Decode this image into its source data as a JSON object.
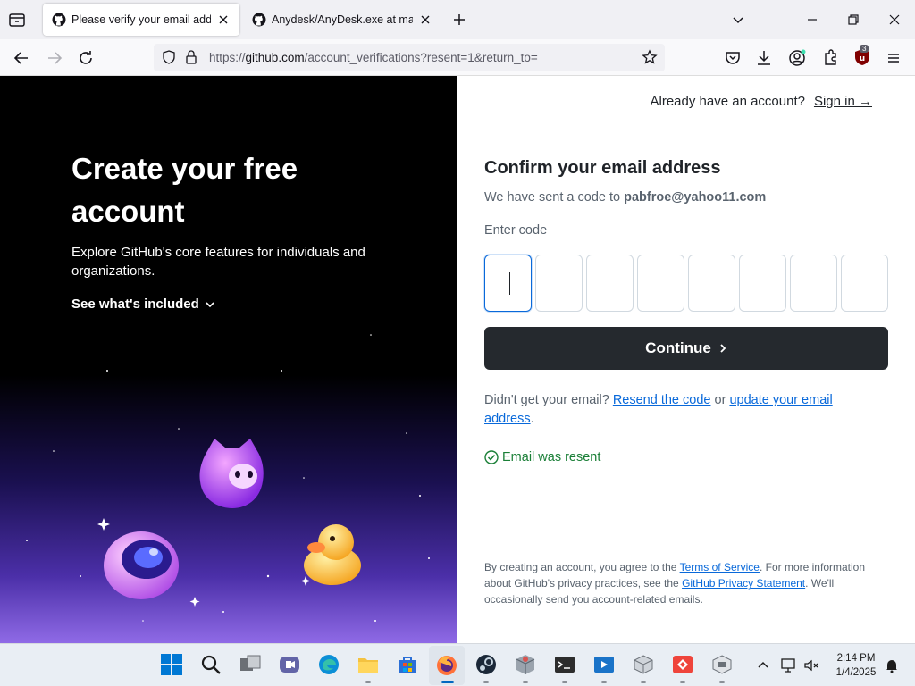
{
  "browser": {
    "tabs": [
      {
        "title": "Please verify your email address",
        "active": true
      },
      {
        "title": "Anydesk/AnyDesk.exe at main",
        "active": false
      }
    ],
    "url_prefix": "https://",
    "url_domain": "github.com",
    "url_path": "/account_verifications?resent=1&return_to=",
    "extension_badge": "3"
  },
  "hero": {
    "title": "Create your free account",
    "subtitle": "Explore GitHub's core features for individuals and organizations.",
    "whats_included": "See what's included"
  },
  "form": {
    "have_account": "Already have an account?",
    "sign_in": "Sign in →",
    "title": "Confirm your email address",
    "sent_text": "We have sent a code to",
    "email": "pabfroe@yahoo11.com",
    "enter_code": "Enter code",
    "code_digits": [
      "",
      "",
      "",
      "",
      "",
      "",
      "",
      ""
    ],
    "continue": "Continue",
    "didnt_get": "Didn't get your email?",
    "resend": "Resend the code",
    "or": "or",
    "update": "update your email address",
    "resent_status": "Email was resent",
    "terms_1": "By creating an account, you agree to the",
    "terms_link": "Terms of Service",
    "terms_2": ". For more information about GitHub's privacy practices, see the",
    "privacy_link": "GitHub Privacy Statement",
    "terms_3": ". We'll occasionally send you account-related emails."
  },
  "taskbar": {
    "time": "2:14 PM",
    "date": "1/4/2025"
  },
  "colors": {
    "accent": "#0969da",
    "button": "#25292e",
    "success": "#1a7f37"
  }
}
